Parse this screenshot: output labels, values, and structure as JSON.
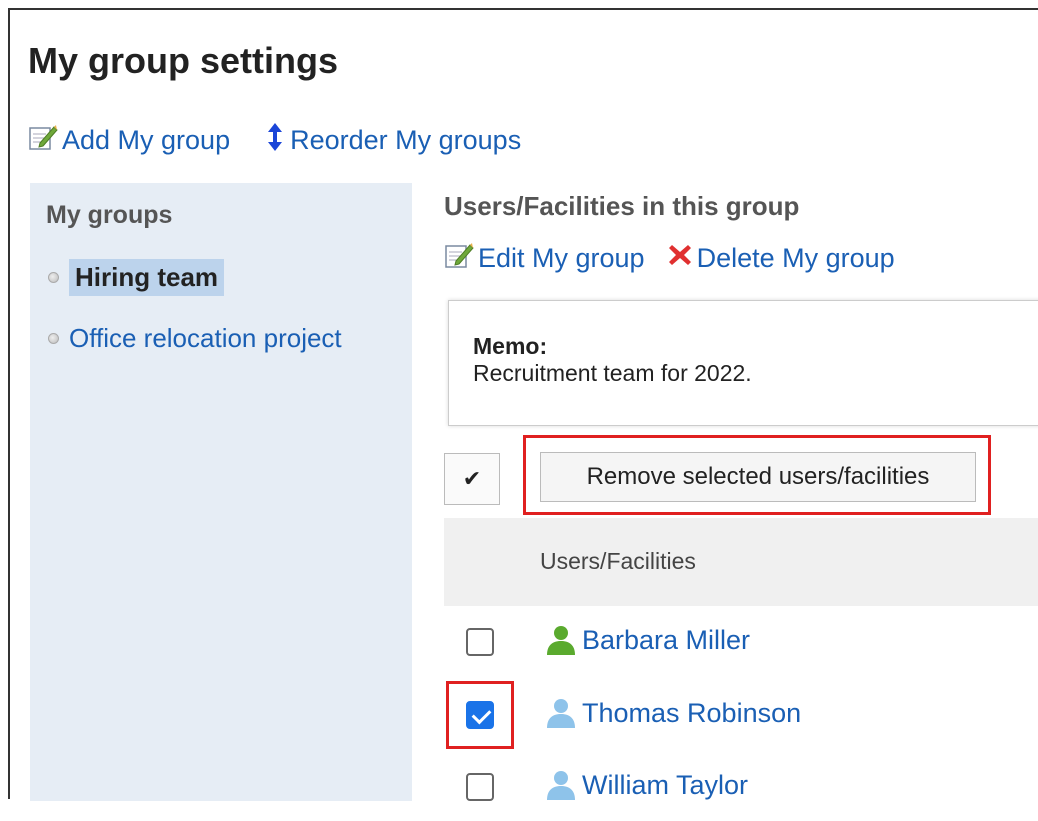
{
  "page": {
    "title": "My group settings"
  },
  "toolbar": {
    "add_label": "Add My group",
    "reorder_label": "Reorder My groups"
  },
  "sidebar": {
    "heading": "My groups",
    "items": [
      {
        "label": "Hiring team",
        "selected": true
      },
      {
        "label": "Office relocation project",
        "selected": false
      }
    ]
  },
  "main": {
    "section_title": "Users/Facilities in this group",
    "edit_label": "Edit My group",
    "delete_label": "Delete My group",
    "memo_label": "Memo:",
    "memo_text": "Recruitment team for 2022.",
    "check_all_symbol": "✔",
    "remove_button_label": "Remove selected users/facilities",
    "column_header": "Users/Facilities",
    "users": [
      {
        "name": "Barbara Miller",
        "checked": false,
        "icon_color": "green"
      },
      {
        "name": "Thomas Robinson",
        "checked": true,
        "icon_color": "light-blue"
      },
      {
        "name": "William Taylor",
        "checked": false,
        "icon_color": "light-blue"
      }
    ]
  },
  "colors": {
    "link": "#1a5fb4",
    "highlight_border": "#e02020",
    "sidebar_bg": "#e6edf5",
    "selected_bg": "#bcd3ec",
    "checkbox_checked": "#1a73e8"
  }
}
